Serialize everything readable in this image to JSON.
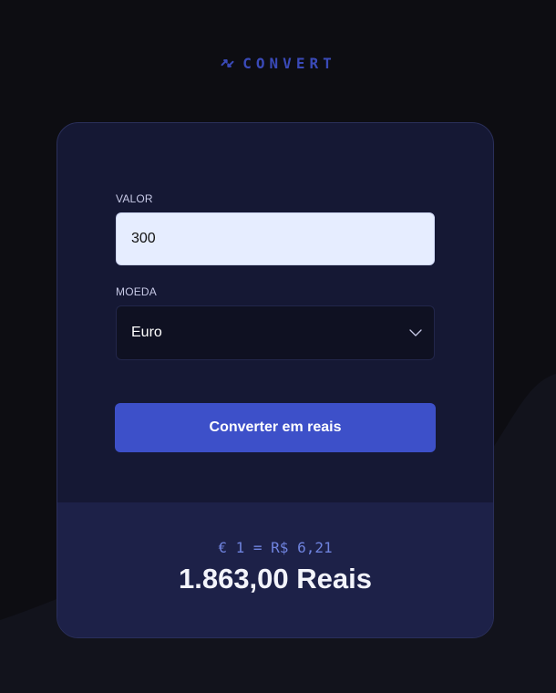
{
  "brand": {
    "name": "CONVERT",
    "icon": "swap-arrows-icon",
    "color": "#3a4ab8"
  },
  "form": {
    "amount_label": "VALOR",
    "amount_value": "300",
    "currency_label": "MOEDA",
    "currency_selected": "Euro",
    "currency_icon": "chevron-down-icon",
    "submit_label": "Converter em reais"
  },
  "result": {
    "rate": "€ 1 = R$ 6,21",
    "total": "1.863,00 Reais"
  },
  "colors": {
    "background": "#0d0d12",
    "card": "#151834",
    "result_panel": "#1d2148",
    "button": "#3d50c9",
    "input": "#e6edff",
    "rate_text": "#6f83de"
  }
}
